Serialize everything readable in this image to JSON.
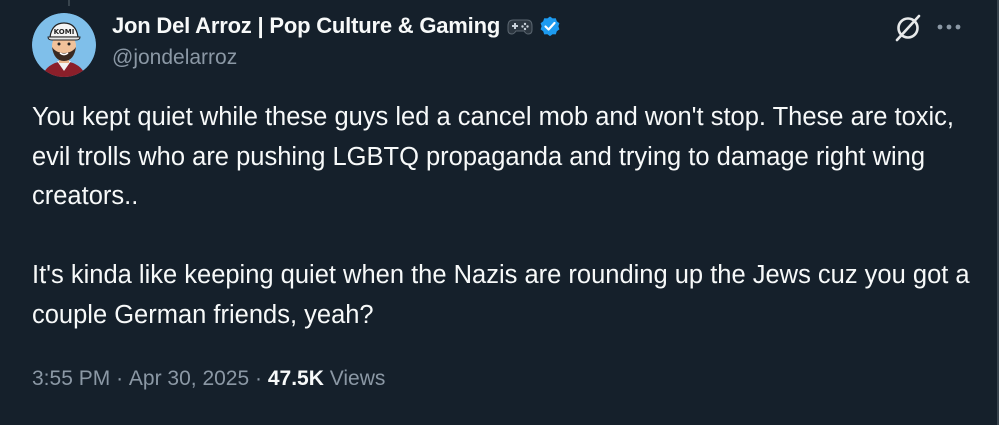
{
  "author": {
    "display_name": "Jon Del Arroz | Pop Culture & Gaming",
    "handle": "@jondelarroz",
    "verified": true,
    "name_emoji": "gamepad-icon",
    "avatar": "avatar-cartoon-man-cap"
  },
  "tweet": {
    "paragraphs": [
      "You kept quiet while these guys led a cancel mob and won't stop. These are toxic, evil trolls who are pushing LGBTQ propaganda and trying to damage right wing creators..",
      "It's kinda like keeping quiet when the Nazis are rounding up the Jews cuz you got a couple German friends, yeah?"
    ]
  },
  "meta": {
    "time": "3:55 PM",
    "separator": "·",
    "date": "Apr 30, 2025",
    "views_count": "47.5K",
    "views_label": "Views"
  },
  "header_actions": {
    "grok": "grok-icon",
    "more": "more-icon"
  },
  "colors": {
    "background": "#15202b",
    "text_primary": "#f7f9f9",
    "text_secondary": "#8b98a5",
    "verified_badge": "#1d9bf0",
    "border": "#38444d"
  }
}
